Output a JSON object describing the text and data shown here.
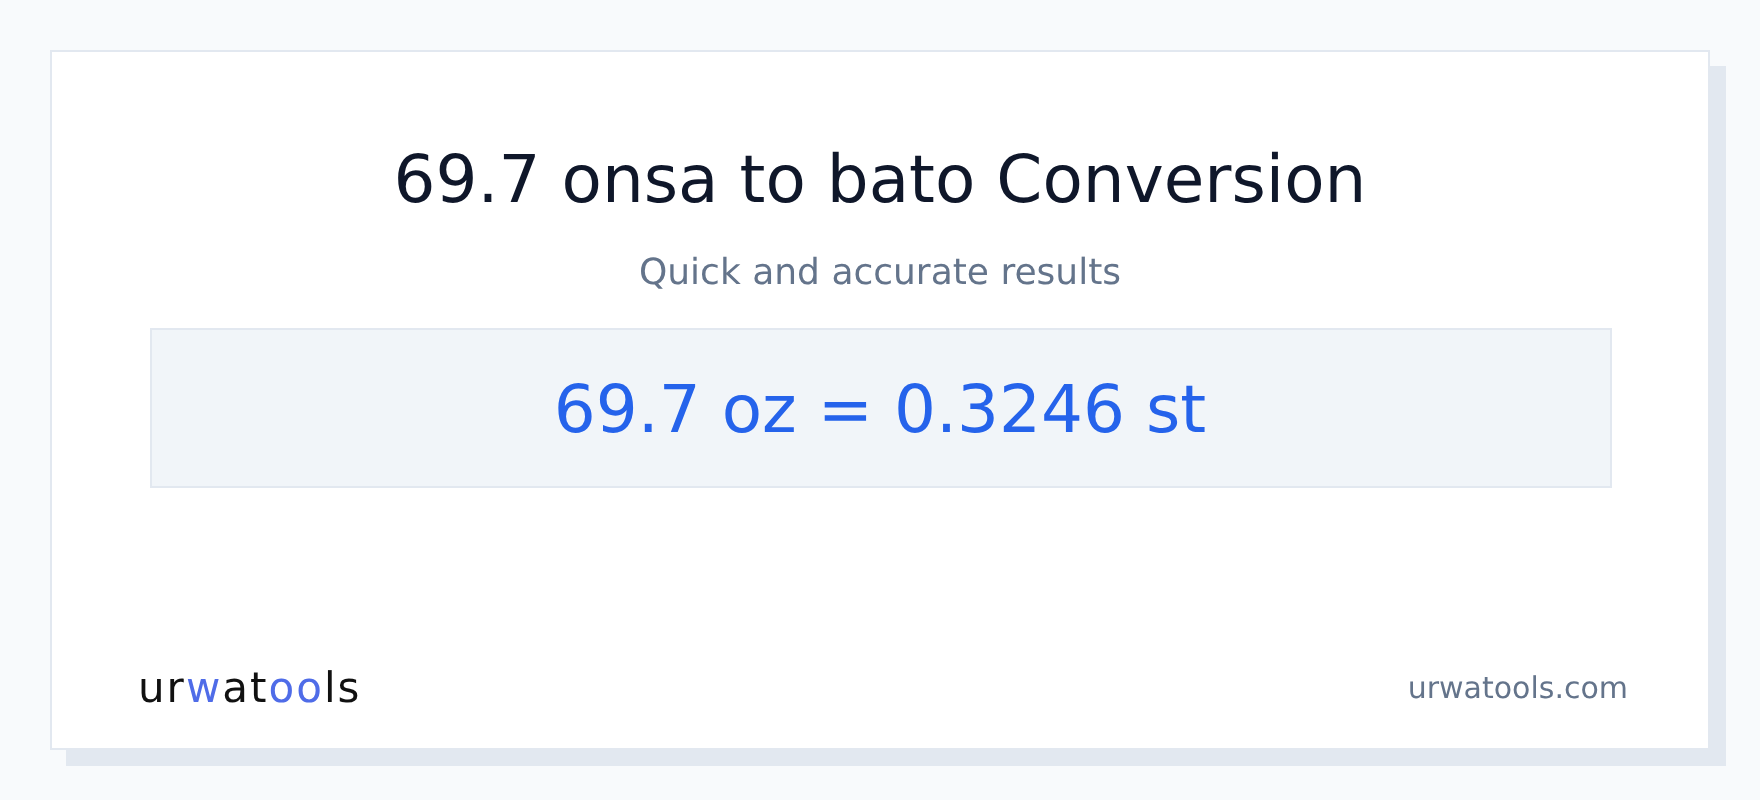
{
  "title": "69.7 onsa to bato Conversion",
  "subtitle": "Quick and accurate results",
  "result": "69.7 oz = 0.3246 st",
  "logo": [
    {
      "text": "ur",
      "accent": false
    },
    {
      "text": "w",
      "accent": true
    },
    {
      "text": "at",
      "accent": false
    },
    {
      "text": "oo",
      "accent": true
    },
    {
      "text": "ls",
      "accent": false
    }
  ],
  "site": "urwatools.com"
}
